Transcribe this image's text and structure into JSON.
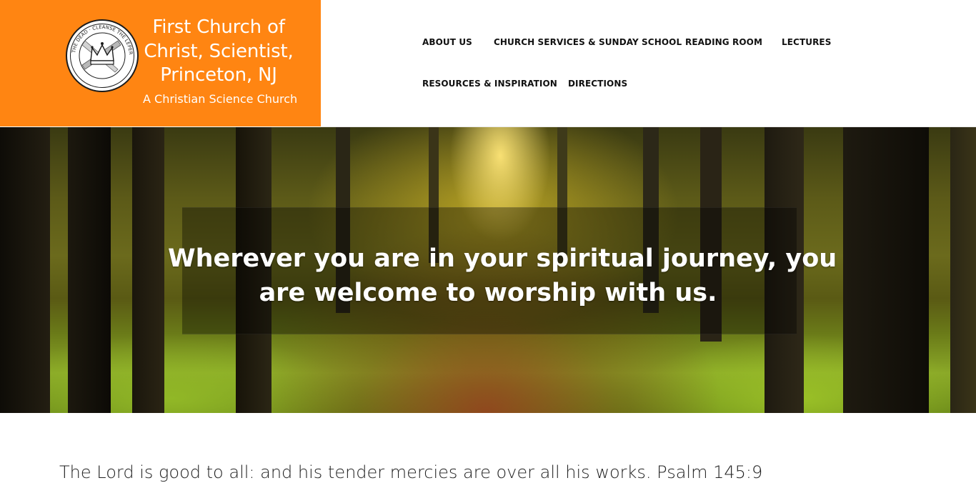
{
  "brand": {
    "seal_icon": "church-seal-logo",
    "seal_text": "HEAL THE SICK · RAISE THE DEAD · CLEANSE THE LEPERS · CAST OUT DEMONS",
    "title_lines": [
      "First Church of",
      "Christ, Scientist,",
      "Princeton, NJ"
    ],
    "subtitle": "A Christian Science Church",
    "color": "#ff8512"
  },
  "nav": {
    "items": [
      {
        "label": "ABOUT US"
      },
      {
        "label": "CHURCH SERVICES & SUNDAY SCHOOL"
      },
      {
        "label": "READING ROOM"
      },
      {
        "label": "LECTURES"
      },
      {
        "label": "RESOURCES & INSPIRATION"
      },
      {
        "label": "DIRECTIONS"
      }
    ]
  },
  "hero": {
    "headline_lines": [
      "Wherever you are in your spiritual journey, you",
      "are welcome to worship with us."
    ]
  },
  "content": {
    "verse": "The Lord is good to all: and his tender mercies are over all his works. Psalm 145:9"
  }
}
